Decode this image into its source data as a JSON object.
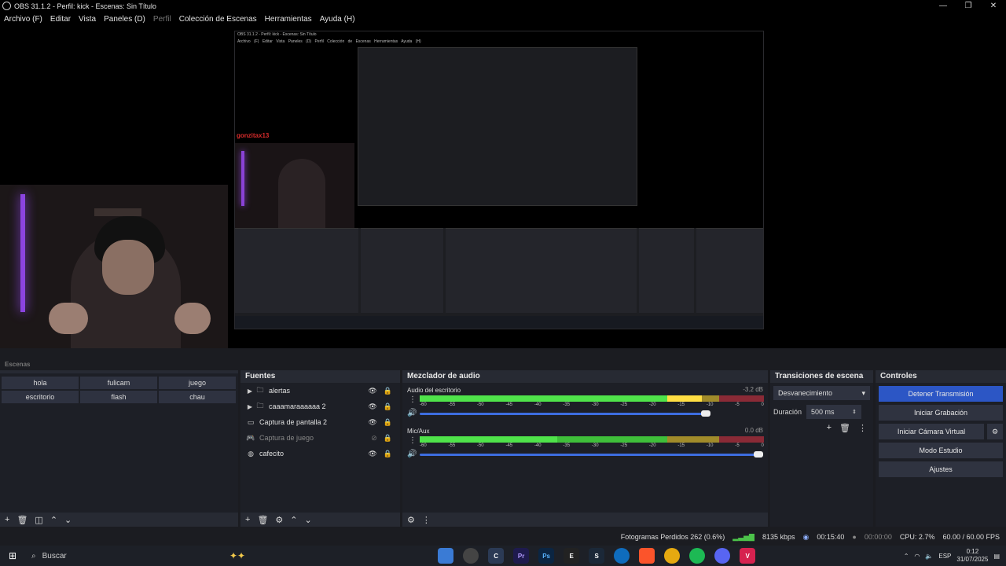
{
  "window": {
    "title": "OBS 31.1.2 - Perfil: kick - Escenas: Sin Título",
    "minimize": "—",
    "restore": "❐",
    "close": "✕"
  },
  "menu": [
    {
      "label": "Archivo (F)",
      "enabled": true
    },
    {
      "label": "Editar",
      "enabled": true
    },
    {
      "label": "Vista",
      "enabled": true
    },
    {
      "label": "Paneles (D)",
      "enabled": true
    },
    {
      "label": "Perfil",
      "enabled": false
    },
    {
      "label": "Colección de Escenas",
      "enabled": true
    },
    {
      "label": "Herramientas",
      "enabled": true
    },
    {
      "label": "Ayuda (H)",
      "enabled": true
    }
  ],
  "preview": {
    "chat_username": "gonzitax13",
    "chat_colon": ":",
    "nested_chat_username": "gonzitax13",
    "nested_title": "OBS 31.1.2 - Perfil: kick - Escenas: Sin Título",
    "nested_menu": "Archivo (F) Editar Vista Paneles (D) Perfil Colección de Escenas Herramientas Ayuda (H)"
  },
  "scenes": {
    "header": "Escenas",
    "items": [
      "hola",
      "fulicam",
      "juego",
      "escritorio",
      "flash",
      "chau"
    ],
    "footer_icons": [
      "+",
      "🗑",
      "◫",
      "⌃",
      "⌄"
    ]
  },
  "sources": {
    "header": "Fuentes",
    "items": [
      {
        "label": "alertas",
        "icon": "folder-icon",
        "expandable": true,
        "dim": false
      },
      {
        "label": "caaamaraaaaaa 2",
        "icon": "folder-icon",
        "expandable": true,
        "dim": false
      },
      {
        "label": "Captura de pantalla 2",
        "icon": "monitor-icon",
        "expandable": false,
        "dim": false
      },
      {
        "label": "Captura de juego",
        "icon": "gamepad-icon",
        "expandable": false,
        "dim": true
      },
      {
        "label": "cafecito",
        "icon": "globe-icon",
        "expandable": false,
        "dim": false
      }
    ]
  },
  "mixer": {
    "header": "Mezclador de audio",
    "scale": [
      "-60",
      "-55",
      "-50",
      "-45",
      "-40",
      "-35",
      "-30",
      "-25",
      "-20",
      "-15",
      "-10",
      "-5",
      "0"
    ],
    "channels": [
      {
        "name": "Audio del escritorio",
        "db": "-3.2 dB",
        "level": 0.82,
        "volume": 0.83
      },
      {
        "name": "Mic/Aux",
        "db": "0.0 dB",
        "level": 0.4,
        "volume": 0.985
      }
    ]
  },
  "transitions": {
    "header": "Transiciones de escena",
    "selected": "Desvanecimiento",
    "duration_label": "Duración",
    "duration_value": "500 ms"
  },
  "controls": {
    "header": "Controles",
    "stop_stream": "Detener Transmisión",
    "start_recording": "Iniciar Grabación",
    "virtual_camera": "Iniciar Cámara Virtual",
    "studio_mode": "Modo Estudio",
    "settings": "Ajustes"
  },
  "status": {
    "dropped_frames": "Fotogramas Perdidos 262 (0.6%)",
    "bitrate": "8135 kbps",
    "stream_time": "00:15:40",
    "record_time": "00:00:00",
    "cpu": "CPU: 2.7%",
    "fps": "60.00 / 60.00 FPS"
  },
  "taskbar": {
    "search_placeholder": "Buscar",
    "lang": "ESP",
    "time": "0:12",
    "date": "31/07/2025"
  },
  "colors": {
    "accent": "#2c56c5",
    "dock_bg": "#272a33",
    "chat_name": "#e02828",
    "meter_green": "#3fbf3a"
  }
}
